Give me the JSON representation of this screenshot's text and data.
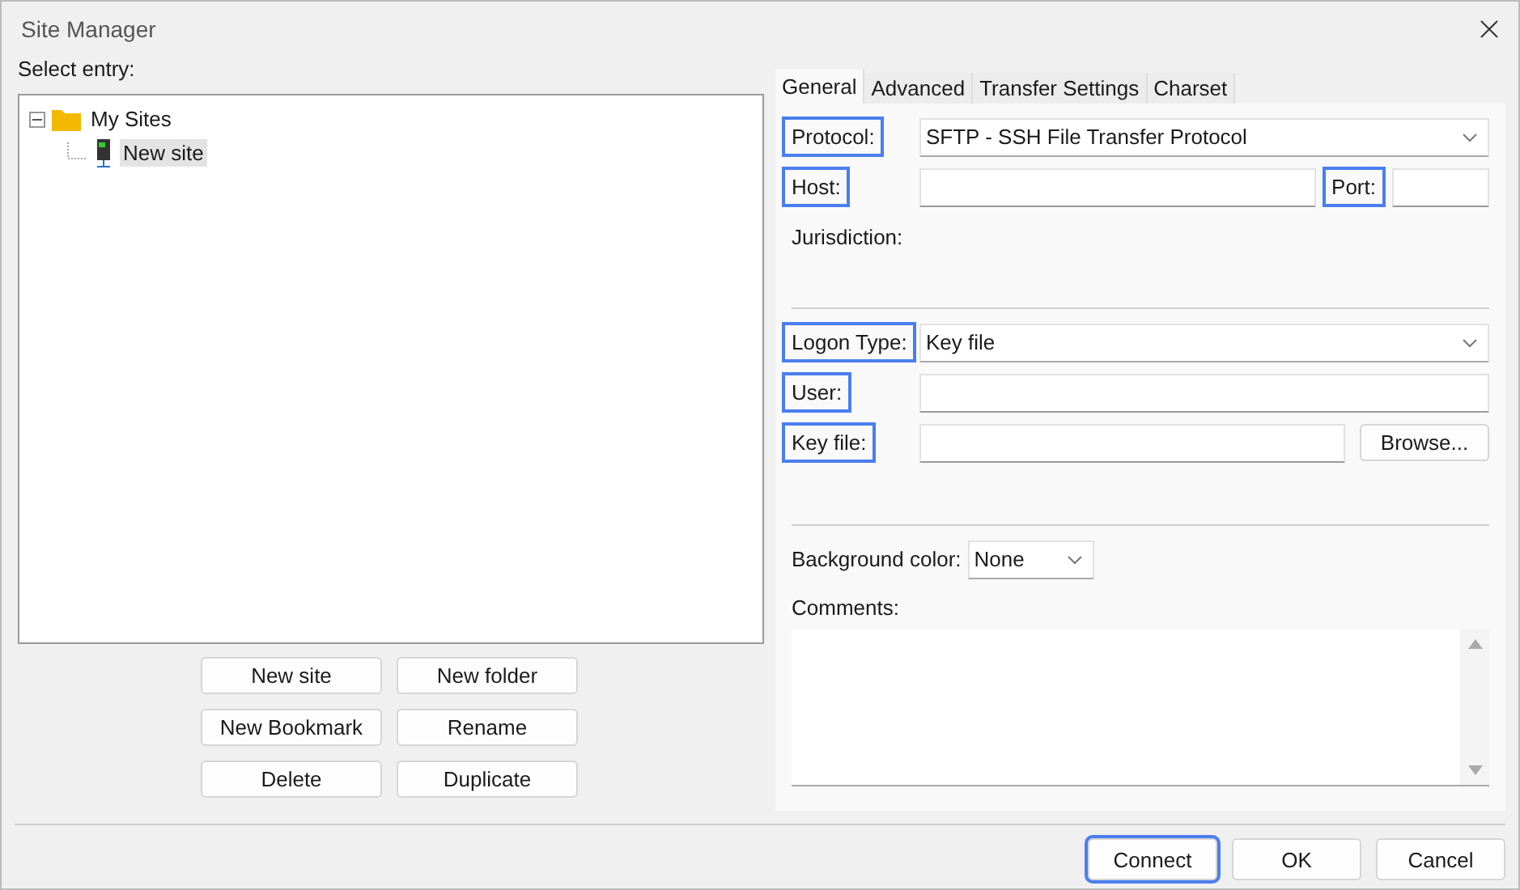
{
  "window": {
    "title": "Site Manager"
  },
  "entries": {
    "label": "Select entry:",
    "tree": [
      {
        "label": "My Sites",
        "kind": "folder",
        "expanded": true,
        "selected": false,
        "children": [
          {
            "label": "New site",
            "kind": "site",
            "selected": true
          }
        ]
      }
    ],
    "buttons": [
      "New site",
      "New folder",
      "New Bookmark",
      "Rename",
      "Delete",
      "Duplicate"
    ]
  },
  "tabs": [
    {
      "label": "General",
      "selected": true
    },
    {
      "label": "Advanced",
      "selected": false
    },
    {
      "label": "Transfer Settings",
      "selected": false
    },
    {
      "label": "Charset",
      "selected": false
    }
  ],
  "sections": [
    [
      {
        "kind": "select",
        "label": "Protocol:",
        "highlighted": true,
        "value": "SFTP - SSH File Transfer Protocol"
      },
      {
        "kind": "host",
        "label": "Host:",
        "highlighted": true,
        "port_label": "Port:",
        "port_highlighted": true
      },
      {
        "kind": "static",
        "label": "Jurisdiction:",
        "highlighted": false
      }
    ],
    [
      {
        "kind": "select",
        "label": "Logon Type:",
        "highlighted": true,
        "value": "Key file"
      },
      {
        "kind": "input",
        "label": "User:",
        "highlighted": true
      },
      {
        "kind": "browse",
        "label": "Key file:",
        "highlighted": true,
        "button": "Browse..."
      }
    ]
  ],
  "background_color": {
    "label": "Background color:",
    "value": "None"
  },
  "comments": {
    "label": "Comments:"
  },
  "footer": [
    {
      "label": "Connect",
      "highlighted": true
    },
    {
      "label": "OK",
      "highlighted": false
    },
    {
      "label": "Cancel",
      "highlighted": false
    }
  ]
}
